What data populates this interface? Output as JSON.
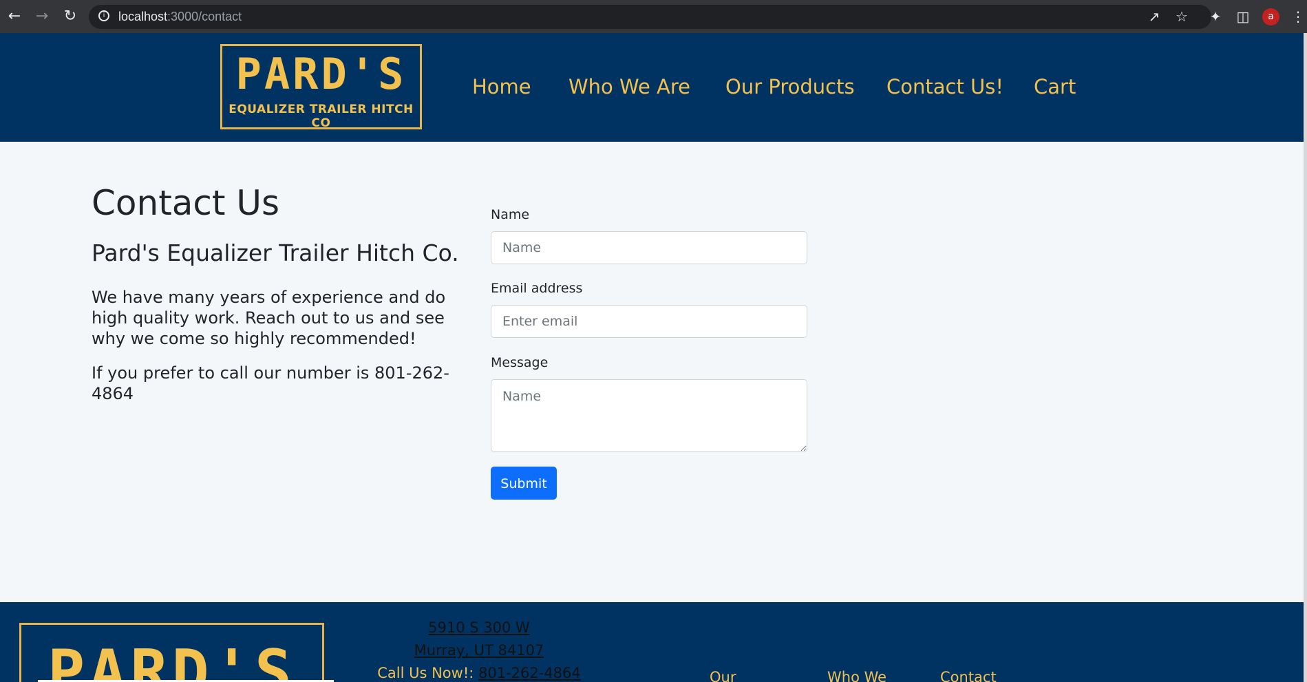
{
  "browser": {
    "url_host": "localhost",
    "url_path": ":3000/contact",
    "avatar_letter": "a"
  },
  "header": {
    "logo_main": "PARD'S",
    "logo_sub": "EQUALIZER TRAILER HITCH CO",
    "nav": [
      "Home",
      "Who We Are",
      "Our Products",
      "Contact Us!",
      "Cart"
    ]
  },
  "main": {
    "title": "Contact Us",
    "company": "Pard's Equalizer Trailer Hitch Co.",
    "blurb": "We have many years of experience and do high quality work. Reach out to us and see why we come so highly recommended!",
    "phone_note": "If you prefer to call our number is 801-262-4864"
  },
  "form": {
    "name_label": "Name",
    "name_placeholder": "Name",
    "email_label": "Email address",
    "email_placeholder": "Enter email",
    "message_label": "Message",
    "message_placeholder": "Name",
    "submit_label": "Submit"
  },
  "footer": {
    "logo_main": "PARD'S",
    "address_line1": "5910 S 300 W",
    "address_line2": "Murray, UT 84107",
    "call_label": "Call Us Now!:",
    "call_number": "801-262-4864",
    "nav": [
      "Our",
      "Who We",
      "Contact"
    ]
  },
  "colors": {
    "navy": "#003262",
    "gold": "#f2c14e",
    "primary": "#0d6efd",
    "background": "#f4f7fa"
  }
}
